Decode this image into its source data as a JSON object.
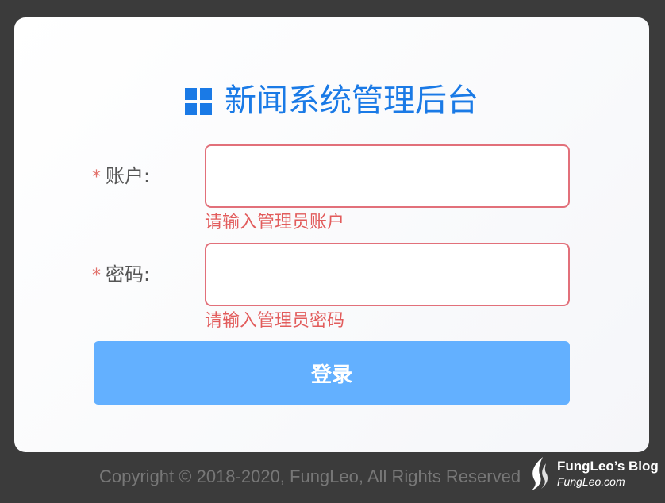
{
  "header": {
    "title": "新闻系统管理后台",
    "icon": "grid-icon",
    "accent_color": "#1a7ae6"
  },
  "form": {
    "account": {
      "required_mark": "*",
      "label": "账户:",
      "value": "",
      "error": "请输入管理员账户"
    },
    "password": {
      "required_mark": "*",
      "label": "密码:",
      "value": "",
      "error": "请输入管理员密码"
    },
    "submit_label": "登录",
    "submit_color": "#63b0ff",
    "error_color": "#e25c5c"
  },
  "footer": {
    "copyright": "Copyright © 2018-2020, FungLeo, All Rights Reserved"
  },
  "watermark": {
    "title": "FungLeo’s Blog",
    "subtitle": "FungLeo.com",
    "icon": "flame-logo-icon"
  }
}
